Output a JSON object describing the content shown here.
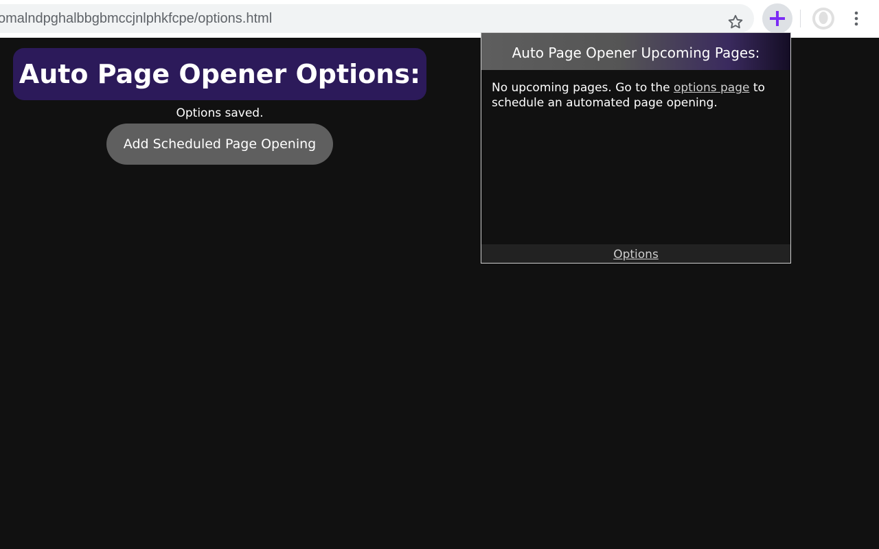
{
  "browser": {
    "url": "omalndpghalbbgbmccjnlphkfcpe/options.html",
    "accent_color": "#7b2cf5"
  },
  "options_page": {
    "title": "Auto Page Opener Options:",
    "status": "Options saved.",
    "add_button_label": "Add Scheduled Page Opening",
    "title_bg_color": "#2c1a5a"
  },
  "popup": {
    "header": "Auto Page Opener Upcoming Pages:",
    "body_before": "No upcoming pages. Go to the ",
    "body_link": "options page",
    "body_after": " to schedule an automated page opening.",
    "footer_link": "Options"
  }
}
